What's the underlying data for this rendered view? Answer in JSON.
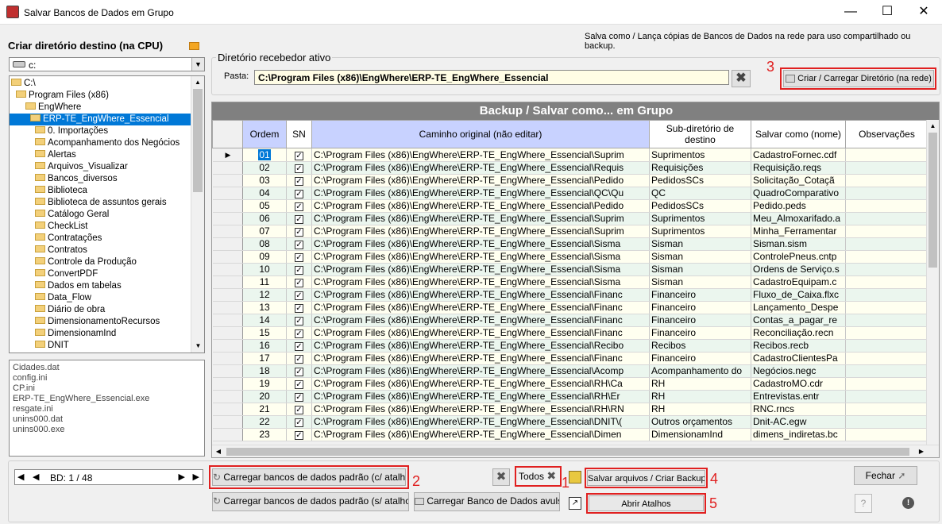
{
  "window": {
    "title": "Salvar Bancos de Dados em Grupo"
  },
  "left": {
    "header": "Criar diretório destino (na CPU)",
    "drive": "c:",
    "tree": [
      "C:\\",
      "Program Files (x86)",
      "EngWhere",
      "ERP-TE_EngWhere_Essencial",
      "0. Importações",
      "Acompanhamento dos Negócios",
      "Alertas",
      "Arquivos_Visualizar",
      "Bancos_diversos",
      "Biblioteca",
      "Biblioteca de assuntos gerais",
      "Catálogo Geral",
      "CheckList",
      "Contratações",
      "Contratos",
      "Controle da Produção",
      "ConvertPDF",
      "Dados em tabelas",
      "Data_Flow",
      "Diário de obra",
      "DimensionamentoRecursos",
      "DimensionamInd",
      "DNIT"
    ],
    "files": [
      "Cidades.dat",
      "config.ini",
      "CP.ini",
      "ERP-TE_EngWhere_Essencial.exe",
      "resgate.ini",
      "unins000.dat",
      "unins000.exe"
    ]
  },
  "top_note": "Salva como / Lança cópias de Bancos de Dados na rede para uso compartilhado ou backup.",
  "diretorio": {
    "legend": "Diretório recebedor ativo",
    "pasta_label": "Pasta:",
    "pasta_value": "C:\\Program Files (x86)\\EngWhere\\ERP-TE_EngWhere_Essencial",
    "criar_button": "Criar / Carregar Diretório (na rede)"
  },
  "grid": {
    "title": "Backup / Salvar como... em Grupo",
    "columns": [
      "Ordem",
      "SN",
      "Caminho original (não editar)",
      "Sub-diretório de destino",
      "Salvar como (nome)",
      "Observações"
    ],
    "rows": [
      [
        "01",
        "C:\\Program Files (x86)\\EngWhere\\ERP-TE_EngWhere_Essencial\\Suprim",
        "Suprimentos",
        "CadastroFornec.cdf"
      ],
      [
        "02",
        "C:\\Program Files (x86)\\EngWhere\\ERP-TE_EngWhere_Essencial\\Requis",
        "Requisições",
        "Requisição.reqs"
      ],
      [
        "03",
        "C:\\Program Files (x86)\\EngWhere\\ERP-TE_EngWhere_Essencial\\Pedido",
        "PedidosSCs",
        "Solicitação_Cotaçã"
      ],
      [
        "04",
        "C:\\Program Files (x86)\\EngWhere\\ERP-TE_EngWhere_Essencial\\QC\\Qu",
        "QC",
        "QuadroComparativo"
      ],
      [
        "05",
        "C:\\Program Files (x86)\\EngWhere\\ERP-TE_EngWhere_Essencial\\Pedido",
        "PedidosSCs",
        "Pedido.peds"
      ],
      [
        "06",
        "C:\\Program Files (x86)\\EngWhere\\ERP-TE_EngWhere_Essencial\\Suprim",
        "Suprimentos",
        "Meu_Almoxarifado.a"
      ],
      [
        "07",
        "C:\\Program Files (x86)\\EngWhere\\ERP-TE_EngWhere_Essencial\\Suprim",
        "Suprimentos",
        "Minha_Ferramentar"
      ],
      [
        "08",
        "C:\\Program Files (x86)\\EngWhere\\ERP-TE_EngWhere_Essencial\\Sisma",
        "Sisman",
        "Sisman.sism"
      ],
      [
        "09",
        "C:\\Program Files (x86)\\EngWhere\\ERP-TE_EngWhere_Essencial\\Sisma",
        "Sisman",
        "ControlePneus.cntp"
      ],
      [
        "10",
        "C:\\Program Files (x86)\\EngWhere\\ERP-TE_EngWhere_Essencial\\Sisma",
        "Sisman",
        "Ordens de Serviço.s"
      ],
      [
        "11",
        "C:\\Program Files (x86)\\EngWhere\\ERP-TE_EngWhere_Essencial\\Sisma",
        "Sisman",
        "CadastroEquipam.c"
      ],
      [
        "12",
        "C:\\Program Files (x86)\\EngWhere\\ERP-TE_EngWhere_Essencial\\Financ",
        "Financeiro",
        "Fluxo_de_Caixa.flxc"
      ],
      [
        "13",
        "C:\\Program Files (x86)\\EngWhere\\ERP-TE_EngWhere_Essencial\\Financ",
        "Financeiro",
        "Lançamento_Despe"
      ],
      [
        "14",
        "C:\\Program Files (x86)\\EngWhere\\ERP-TE_EngWhere_Essencial\\Financ",
        "Financeiro",
        "Contas_a_pagar_re"
      ],
      [
        "15",
        "C:\\Program Files (x86)\\EngWhere\\ERP-TE_EngWhere_Essencial\\Financ",
        "Financeiro",
        "Reconciliação.recn"
      ],
      [
        "16",
        "C:\\Program Files (x86)\\EngWhere\\ERP-TE_EngWhere_Essencial\\Recibo",
        "Recibos",
        "Recibos.recb"
      ],
      [
        "17",
        "C:\\Program Files (x86)\\EngWhere\\ERP-TE_EngWhere_Essencial\\Financ",
        "Financeiro",
        "CadastroClientesPa"
      ],
      [
        "18",
        "C:\\Program Files (x86)\\EngWhere\\ERP-TE_EngWhere_Essencial\\Acomp",
        "Acompanhamento do",
        "Negócios.negc"
      ],
      [
        "19",
        "C:\\Program Files (x86)\\EngWhere\\ERP-TE_EngWhere_Essencial\\RH\\Ca",
        "RH",
        "CadastroMO.cdr"
      ],
      [
        "20",
        "C:\\Program Files (x86)\\EngWhere\\ERP-TE_EngWhere_Essencial\\RH\\Er",
        "RH",
        "Entrevistas.entr"
      ],
      [
        "21",
        "C:\\Program Files (x86)\\EngWhere\\ERP-TE_EngWhere_Essencial\\RH\\RN",
        "RH",
        "RNC.rncs"
      ],
      [
        "22",
        "C:\\Program Files (x86)\\EngWhere\\ERP-TE_EngWhere_Essencial\\DNIT\\(",
        "Outros orçamentos",
        "Dnit-AC.egw"
      ],
      [
        "23",
        "C:\\Program Files (x86)\\EngWhere\\ERP-TE_EngWhere_Essencial\\Dimen",
        "DimensionamInd",
        "dimens_indiretas.bc"
      ]
    ]
  },
  "bottom": {
    "nav_text": "BD: 1 / 48",
    "btn_carregar_c": "Carregar bancos de dados padrão (c/ atalhos)",
    "btn_carregar_s": "Carregar bancos de dados padrão (s/ atalho)",
    "btn_avulso": "Carregar Banco de Dados avulso",
    "btn_todos": "Todos",
    "btn_salvar": "Salvar arquivos / Criar Backup",
    "btn_abrir": "Abrir Atalhos",
    "btn_fechar": "Fechar"
  },
  "annotations": [
    "1",
    "2",
    "3",
    "4",
    "5"
  ],
  "colors": {
    "grid_title_bg": "#808080",
    "header_blue": "#c8d2ff",
    "row_odd": "#fffff0",
    "row_even": "#ebf6ee",
    "selected": "#0078d7",
    "annot_red": "#e02020"
  }
}
